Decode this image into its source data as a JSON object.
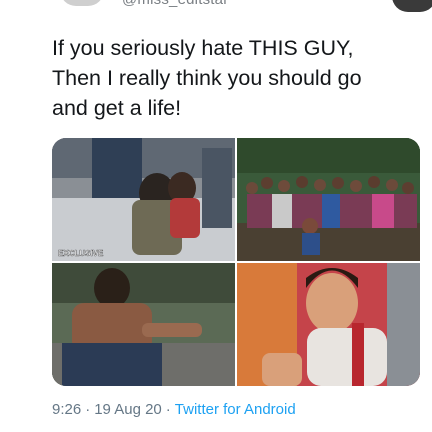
{
  "header": {
    "handle": "@miss_editstar"
  },
  "tweet": {
    "text": "If you seriously hate THIS GUY,\nThen I really think you should go\nand get a life!"
  },
  "media": {
    "badge": "EXCLUSIVE"
  },
  "meta": {
    "time": "9:26",
    "date": "19 Aug 20",
    "source": "Twitter for Android",
    "separator": "·"
  },
  "colors": {
    "text": "#14171a",
    "meta": "#657786",
    "link": "#1da1f2"
  }
}
